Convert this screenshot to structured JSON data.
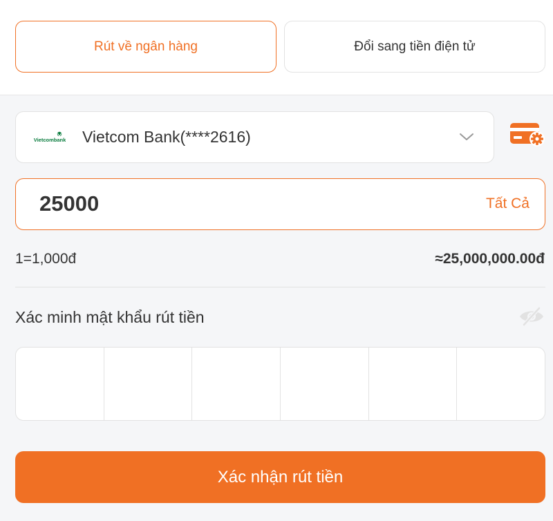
{
  "tabs": [
    {
      "label": "Rút về ngân hàng",
      "active": true
    },
    {
      "label": "Đổi sang tiền điện tử",
      "active": false
    }
  ],
  "bank": {
    "logo_text": "Vietcombank",
    "name": "Vietcom Bank(****2616)",
    "logo_icon": "vietcombank-logo",
    "dropdown_icon": "chevron-down-icon"
  },
  "card_settings_icon": "card-settings-icon",
  "amount": {
    "value": "25000",
    "all_label": "Tất Cả"
  },
  "rate": "1=1,000đ",
  "converted": "≈25,000,000.00đ",
  "password": {
    "label": "Xác minh mật khẩu rút tiền",
    "toggle_icon": "eye-off-icon",
    "digits": [
      "",
      "",
      "",
      "",
      "",
      ""
    ]
  },
  "confirm_label": "Xác nhận rút tiền",
  "colors": {
    "accent": "#f07024",
    "background": "#f5f6f8",
    "border": "#e2e2e2"
  }
}
